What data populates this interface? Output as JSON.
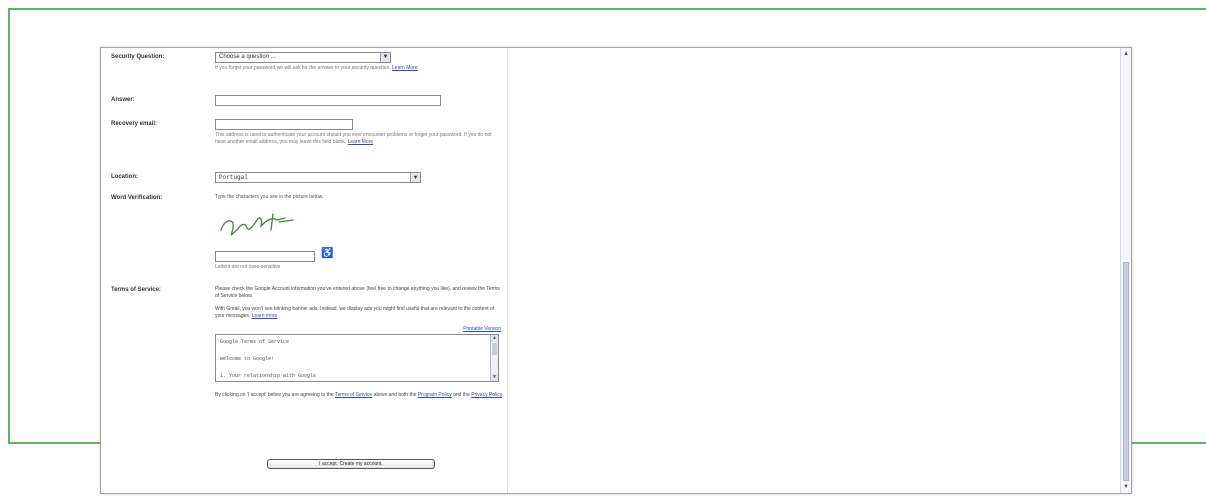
{
  "colors": {
    "frame_accent": "#5fb45f",
    "link": "#2a4ebd"
  },
  "form": {
    "security_question": {
      "label": "Security Question:",
      "selected": "Choose a question ...",
      "help": "If you forget your password we will ask for the answer to your security question.",
      "help_link": "Learn More"
    },
    "answer": {
      "label": "Answer:",
      "value": ""
    },
    "recovery_email": {
      "label": "Recovery email:",
      "value": "",
      "help": "This address is used to authenticate your account should you ever encounter problems or forget your password. If you do not have another email address, you may leave this field blank.",
      "help_link": "Learn More"
    },
    "location": {
      "label": "Location:",
      "selected": "Portugal"
    },
    "word_verification": {
      "label": "Word Verification:",
      "instruction": "Type the characters you see in the picture below.",
      "captcha_word": "gerhzer",
      "input_value": "",
      "help": "Letters are not case-sensitive",
      "accessibility_icon": "wheelchair-icon"
    },
    "terms": {
      "label": "Terms of Service:",
      "para1": "Please check the Google Account information you've entered above (feel free to change anything you like), and review the Terms of Service below.",
      "para2": "With Gmail, you won't see blinking banner ads. Instead, we display ads you might find useful that are relevant to the content of your messages.",
      "para2_link": "Learn more",
      "printable_link": "Printable Version",
      "tos_lines": [
        "Google Terms of Service",
        "Welcome to Google!",
        "1. Your relationship with Google"
      ],
      "agree_text": "By clicking on 'I accept' below you are agreeing to the",
      "agree_link_tos": "Terms of Service",
      "agree_text2": "above and both the",
      "agree_link_program": "Program Policy",
      "agree_text3": "and the",
      "agree_link_privacy": "Privacy Policy",
      "accept_button": "I accept. Create my account."
    }
  },
  "scrollbar": {
    "up_icon": "up-arrow-icon",
    "down_icon": "down-arrow-icon",
    "position_fraction": 0.48
  }
}
